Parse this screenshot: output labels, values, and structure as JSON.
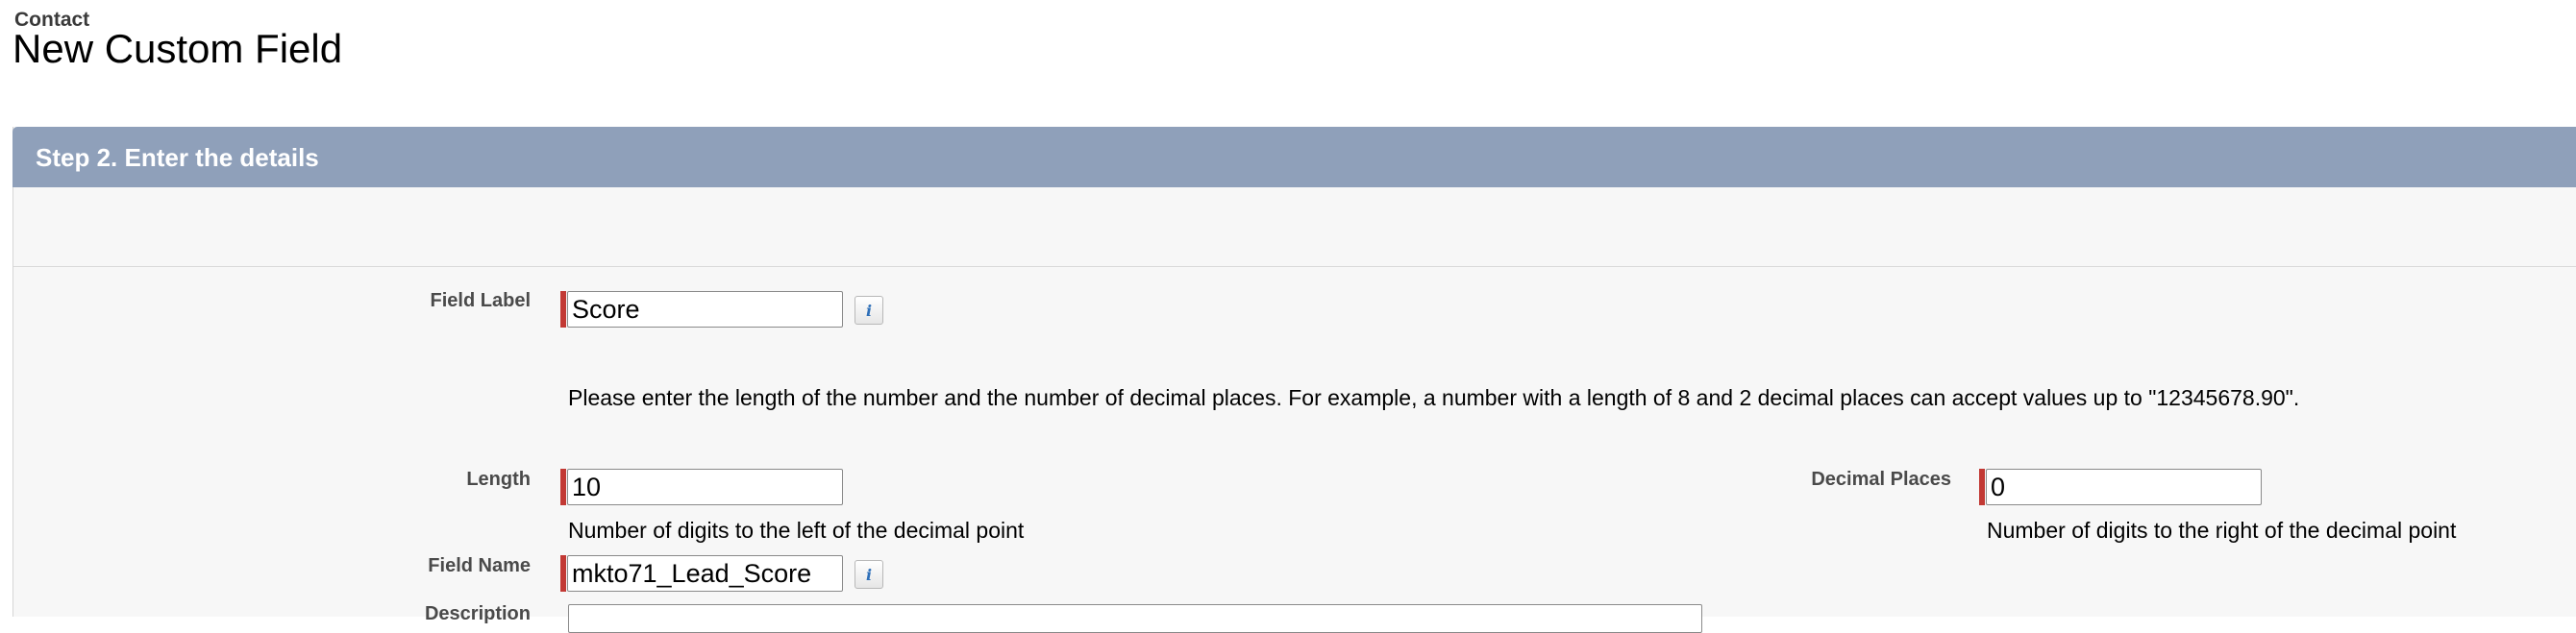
{
  "breadcrumb": "Contact",
  "page_title": "New Custom Field",
  "step": {
    "title": "Step 2. Enter the details"
  },
  "form": {
    "field_label": {
      "label": "Field Label",
      "value": "Score"
    },
    "instructions": "Please enter the length of the number and the number of decimal places. For example, a number with a length of 8 and 2 decimal places can accept values up to \"12345678.90\".",
    "length": {
      "label": "Length",
      "value": "10",
      "help": "Number of digits to the left of the decimal point"
    },
    "decimal_places": {
      "label": "Decimal Places",
      "value": "0",
      "help": "Number of digits to the right of the decimal point"
    },
    "field_name": {
      "label": "Field Name",
      "value": "mkto71_Lead_Score"
    },
    "description": {
      "label": "Description",
      "value": ""
    }
  },
  "icons": {
    "info": "info-icon"
  },
  "colors": {
    "header_bg": "#8fa0ba",
    "required_bar": "#c23934",
    "panel_bg": "#f7f7f7"
  }
}
